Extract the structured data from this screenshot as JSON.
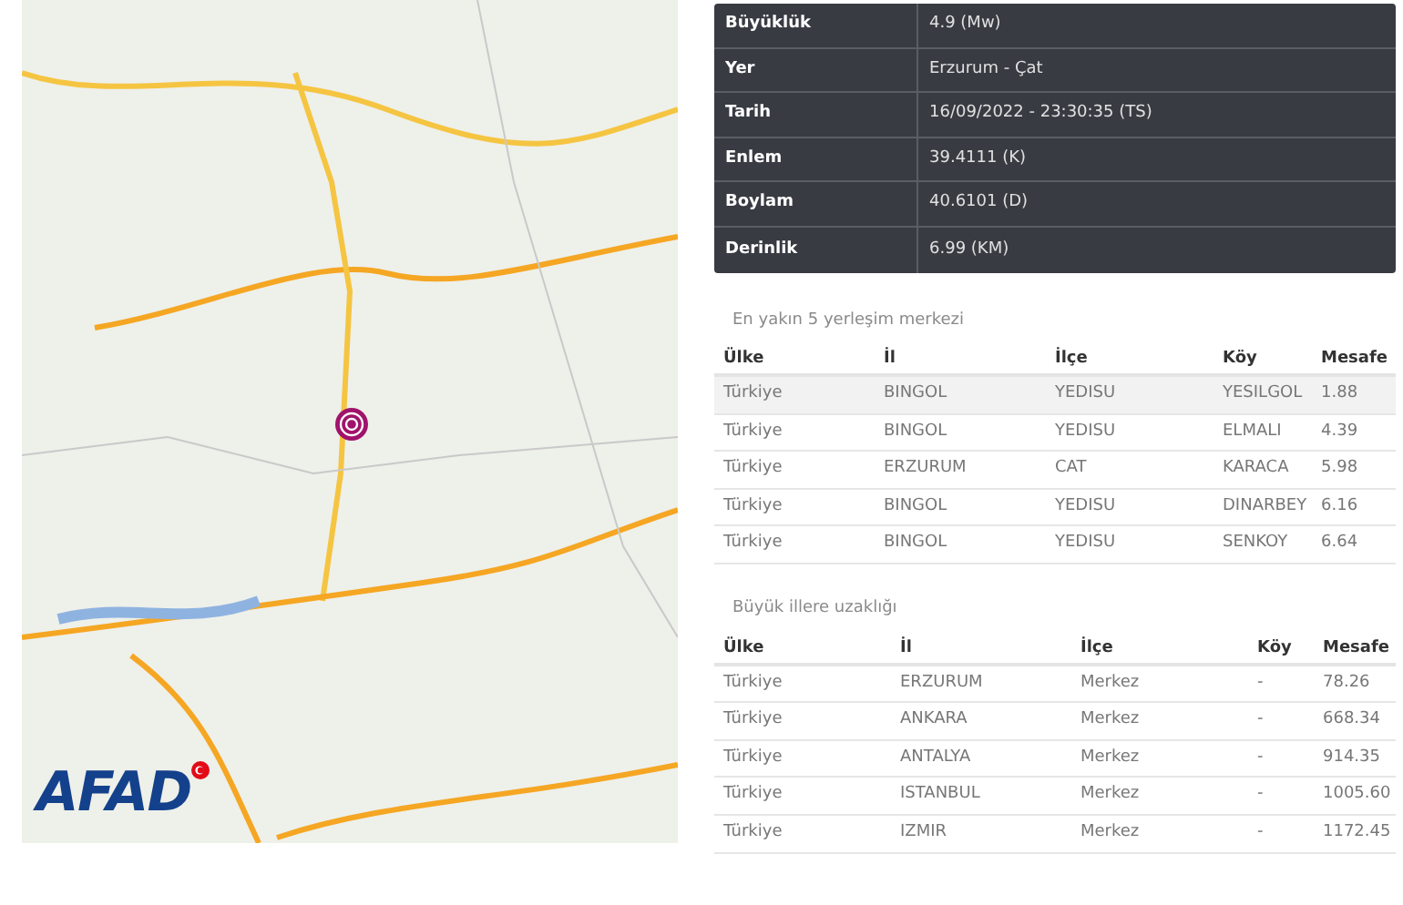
{
  "map": {
    "logo": "AFAD"
  },
  "details": [
    {
      "label": "Büyüklük",
      "value": "4.9 (Mw)"
    },
    {
      "label": "Yer",
      "value": "Erzurum - Çat"
    },
    {
      "label": "Tarih",
      "value": "16/09/2022 - 23:30:35 (TS)"
    },
    {
      "label": "Enlem",
      "value": "39.4111 (K)"
    },
    {
      "label": "Boylam",
      "value": "40.6101 (D)"
    },
    {
      "label": "Derinlik",
      "value": "6.99 (KM)"
    }
  ],
  "tables": [
    {
      "title": "En yakın 5 yerleşim merkezi",
      "columns": [
        "Ülke",
        "İl",
        "İlçe",
        "Köy",
        "Mesafe"
      ],
      "rows": [
        [
          "Türkiye",
          "BINGOL",
          "YEDISU",
          "YESILGOL",
          "1.88"
        ],
        [
          "Türkiye",
          "BINGOL",
          "YEDISU",
          "ELMALI",
          "4.39"
        ],
        [
          "Türkiye",
          "ERZURUM",
          "CAT",
          "KARACA",
          "5.98"
        ],
        [
          "Türkiye",
          "BINGOL",
          "YEDISU",
          "DINARBEY",
          "6.16"
        ],
        [
          "Türkiye",
          "BINGOL",
          "YEDISU",
          "SENKOY",
          "6.64"
        ]
      ]
    },
    {
      "title": "Büyük illere uzaklığı",
      "columns": [
        "Ülke",
        "İl",
        "İlçe",
        "Köy",
        "Mesafe"
      ],
      "rows": [
        [
          "Türkiye",
          "ERZURUM",
          "Merkez",
          "-",
          "78.26"
        ],
        [
          "Türkiye",
          "ANKARA",
          "Merkez",
          "-",
          "668.34"
        ],
        [
          "Türkiye",
          "ANTALYA",
          "Merkez",
          "-",
          "914.35"
        ],
        [
          "Türkiye",
          "ISTANBUL",
          "Merkez",
          "-",
          "1005.60"
        ],
        [
          "Türkiye",
          "IZMIR",
          "Merkez",
          "-",
          "1172.45"
        ]
      ]
    }
  ]
}
